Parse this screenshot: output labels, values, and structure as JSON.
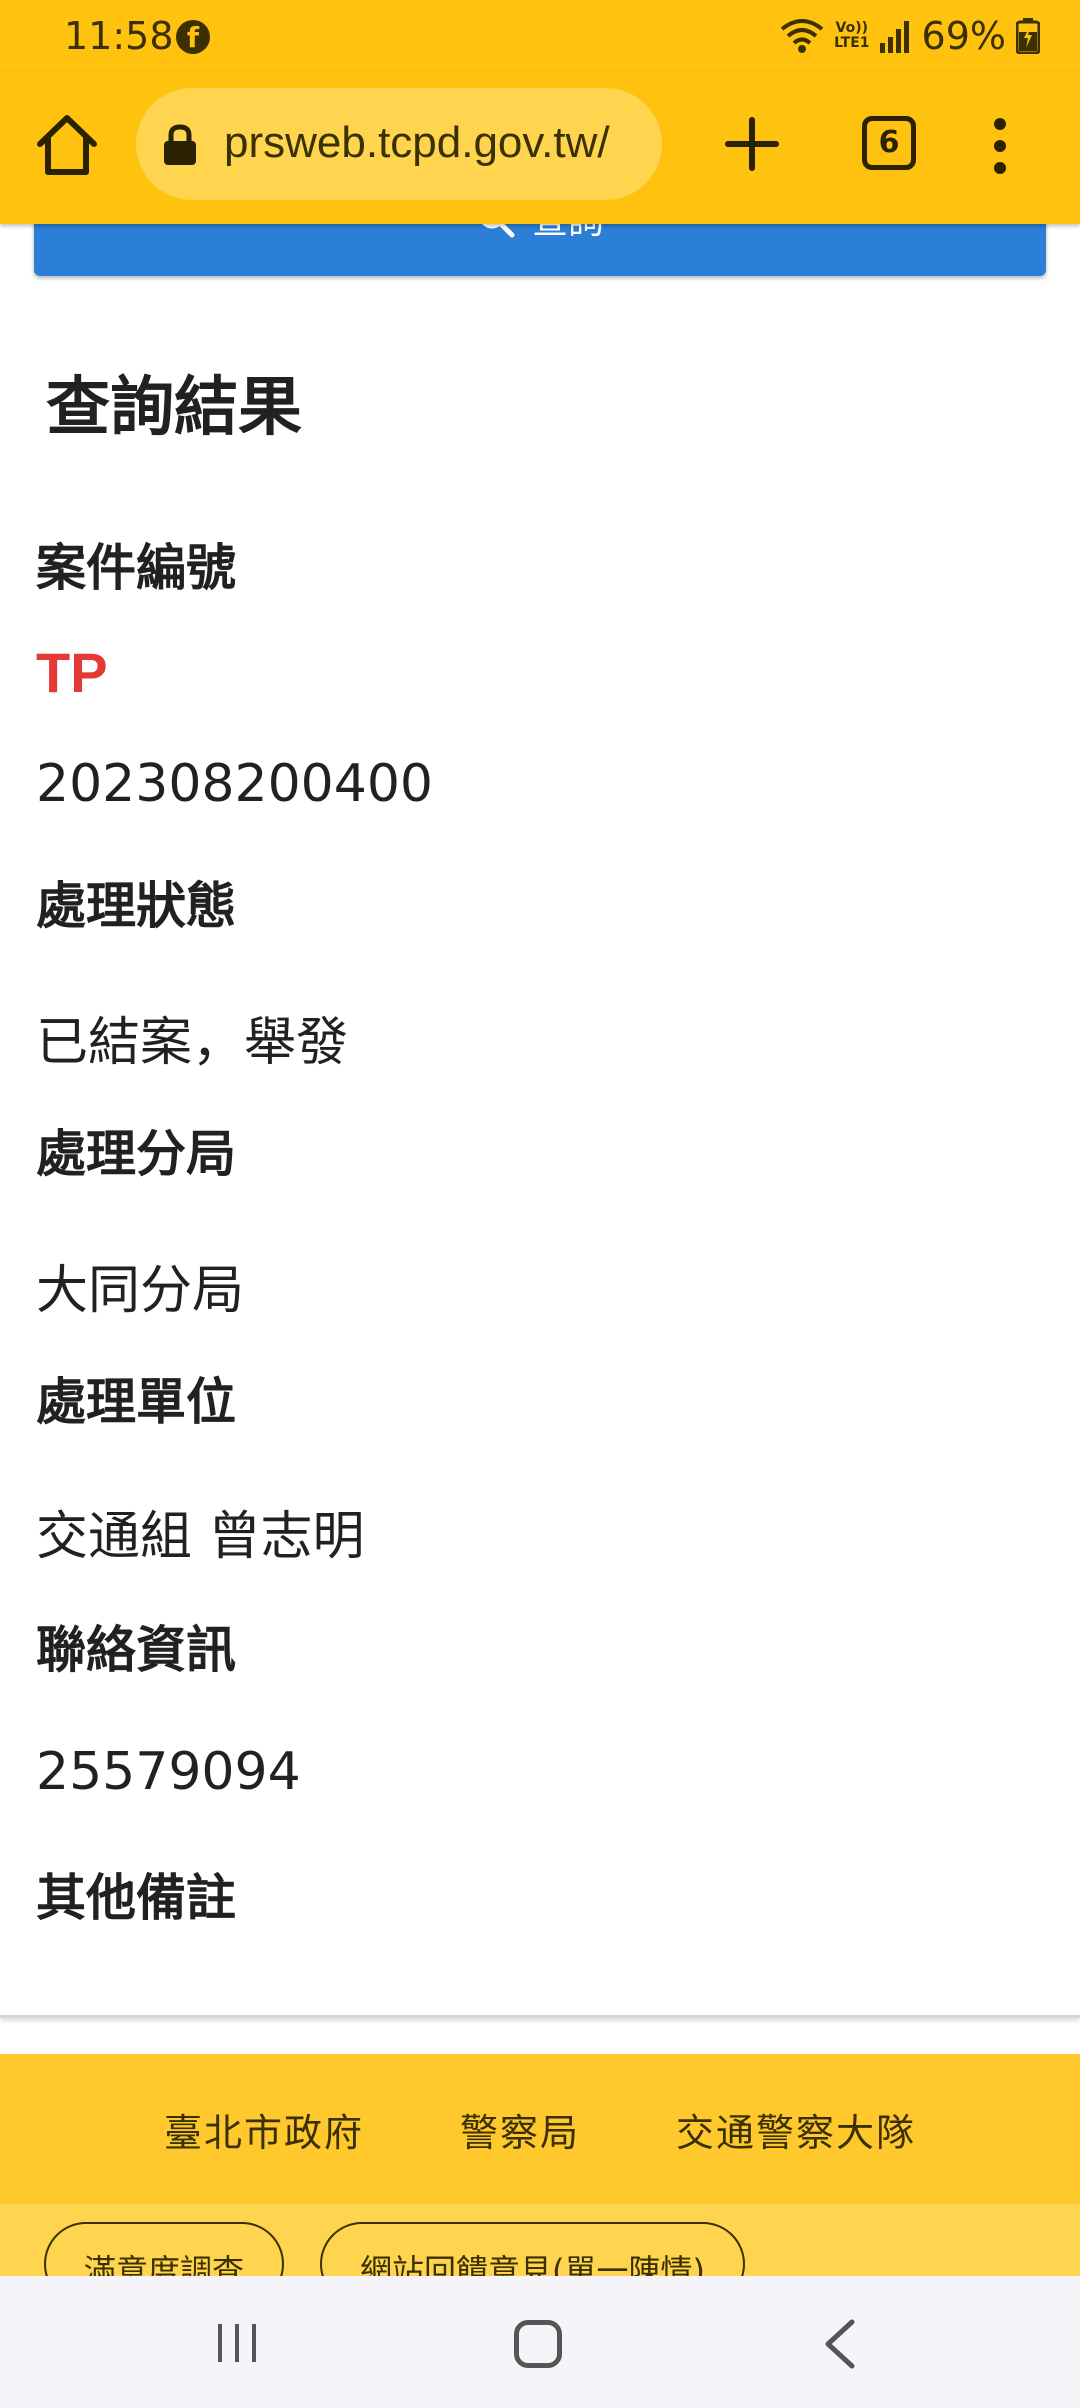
{
  "status_bar": {
    "time": "11:58",
    "app_icon": "facebook-icon",
    "network_top": "Vo))",
    "network_bottom": "LTE1",
    "battery": "69%"
  },
  "toolbar": {
    "url": "prsweb.tcpd.gov.tw/",
    "tab_count": "6",
    "home_icon": "home-icon",
    "lock_icon": "lock-icon",
    "new_tab_icon": "plus-icon",
    "menu_icon": "more-vert-icon"
  },
  "query_button": {
    "label": "查詢",
    "icon": "search-icon",
    "color": "#2B7FD6"
  },
  "result": {
    "title": "查詢結果",
    "case_label": "案件編號",
    "case_prefix": "TP",
    "case_number": "202308200400",
    "status_label": "處理狀態",
    "status_value": "已結案，舉發",
    "branch_label": "處理分局",
    "branch_value": "大同分局",
    "unit_label": "處理單位",
    "unit_value": "交通組 曾志明",
    "contact_label": "聯絡資訊",
    "contact_value": "25579094",
    "notes_label": "其他備註"
  },
  "footer": {
    "links": [
      "臺北市政府",
      "警察局",
      "交通警察大隊"
    ],
    "pills": [
      "滿意度調查",
      "網站回饋意見(單一陳情)"
    ]
  },
  "colors": {
    "accent_yellow": "#FFC20E",
    "case_prefix_red": "#E53935",
    "footer_yellow": "#FFC82C"
  }
}
